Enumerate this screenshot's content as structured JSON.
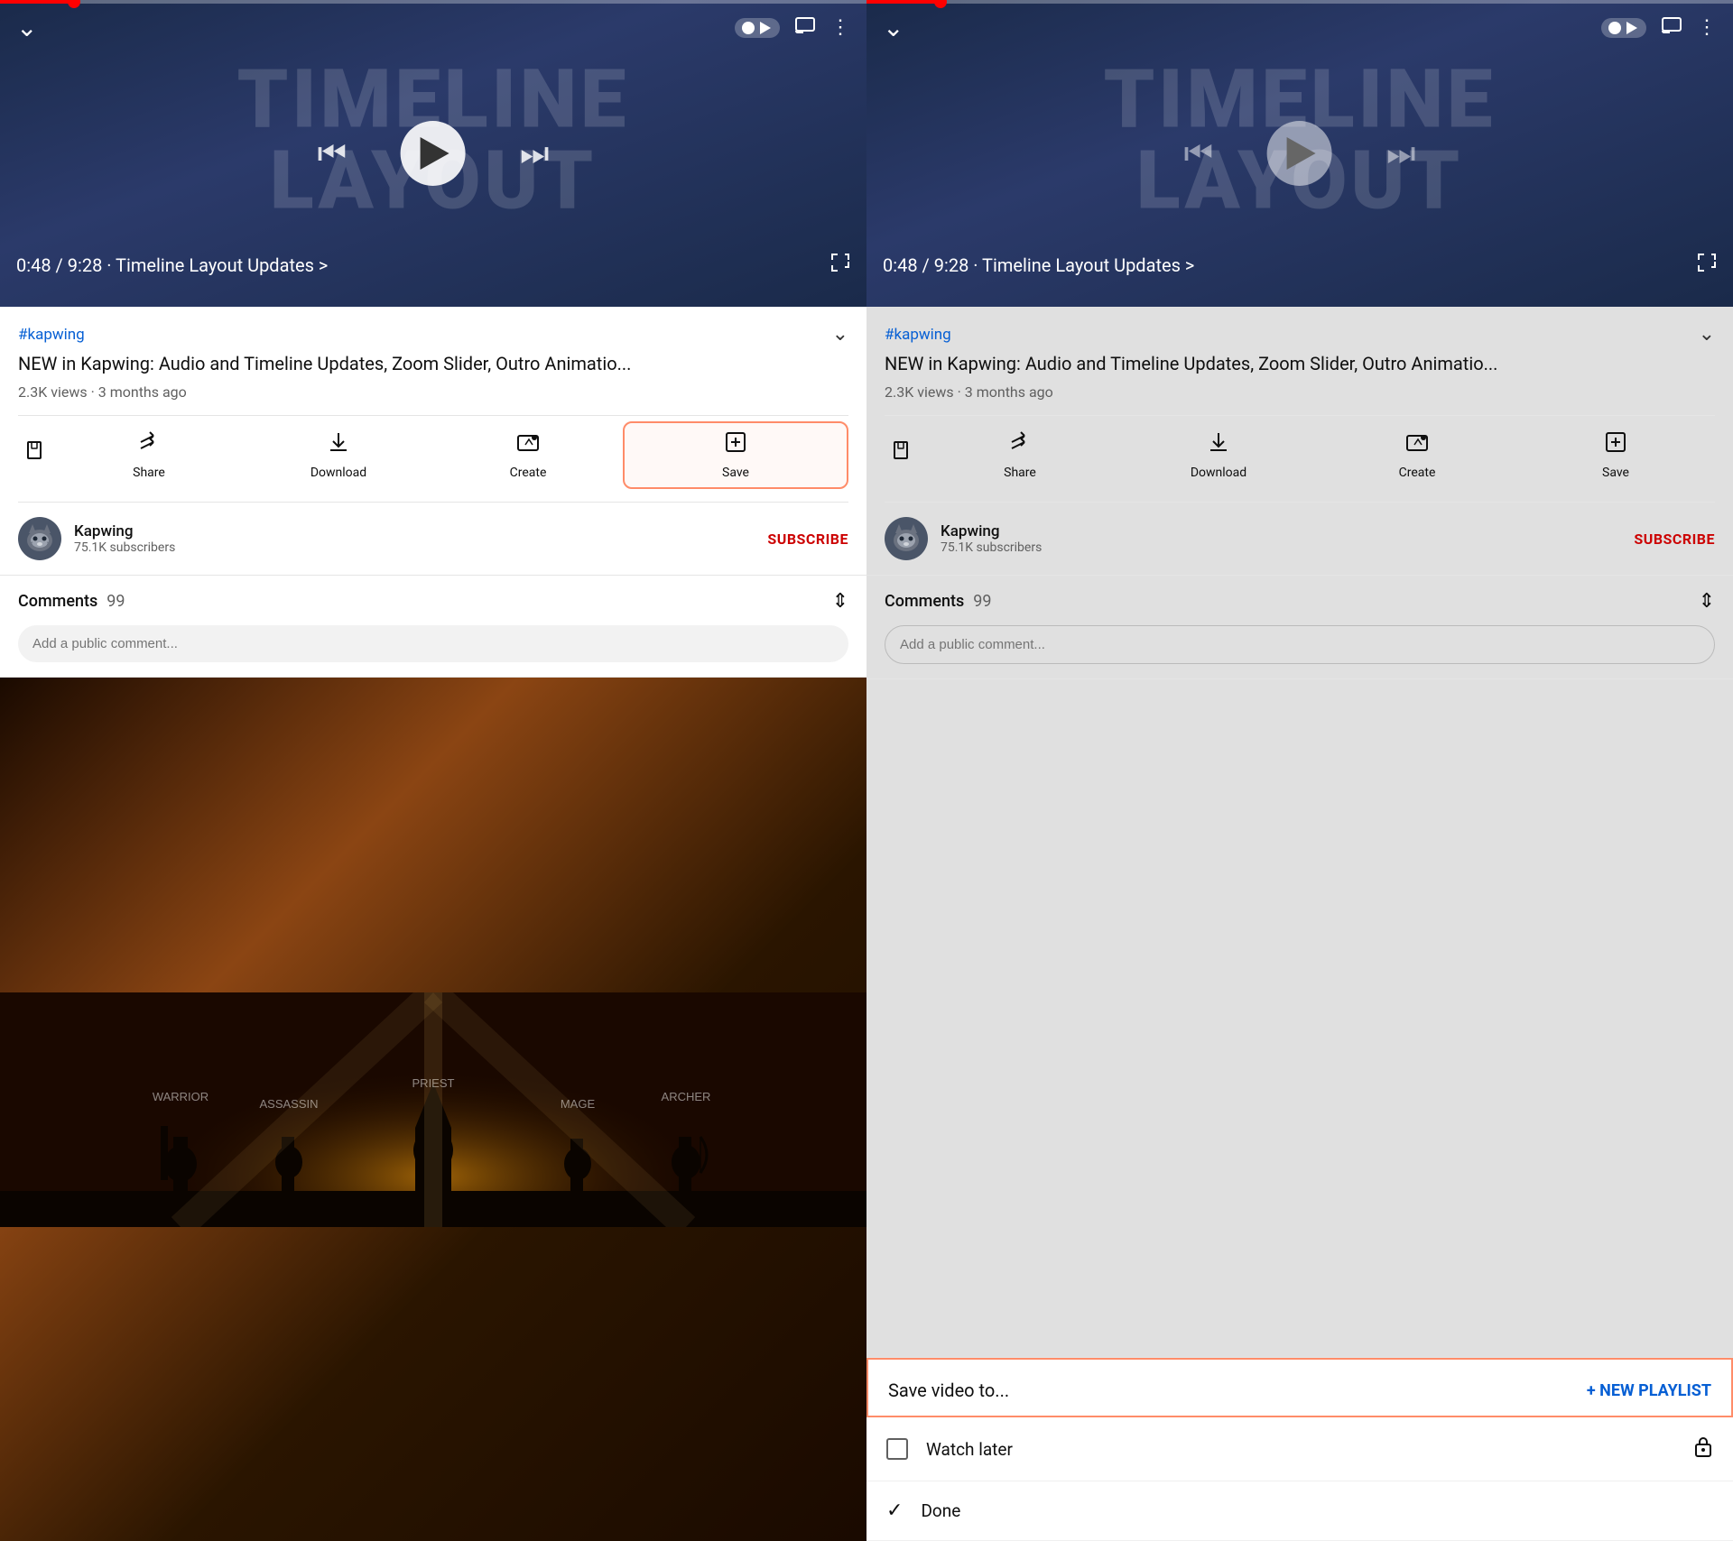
{
  "panels": [
    {
      "id": "left",
      "video": {
        "title_bg": "TIMELINE\nLAYOUT",
        "time": "0:48 / 9:28 · Timeline Layout Updates >",
        "progress_percent": 8.5
      },
      "hashtag": "#kapwing",
      "video_title": "NEW in Kapwing: Audio and Timeline Updates, Zoom Slider, Outro Animatio...",
      "meta": "2.3K views · 3 months ago",
      "actions": [
        {
          "id": "save-left",
          "icon": "↓",
          "label": "Save"
        },
        {
          "id": "share",
          "icon": "↗",
          "label": "Share"
        },
        {
          "id": "download",
          "icon": "↓",
          "label": "Download"
        },
        {
          "id": "create",
          "icon": "📷",
          "label": "Create"
        },
        {
          "id": "save",
          "icon": "＋",
          "label": "Save",
          "highlighted": true
        }
      ],
      "channel_name": "Kapwing",
      "channel_subs": "75.1K subscribers",
      "subscribe": "SUBSCRIBE",
      "comments_label": "Comments",
      "comments_count": "99",
      "comment_placeholder": "Add a public comment...",
      "has_thumbnail": true
    },
    {
      "id": "right",
      "video": {
        "title_bg": "TIMELINE\nLAYOUT",
        "time": "0:48 / 9:28 · Timeline Layout Updates >",
        "progress_percent": 8.5
      },
      "hashtag": "#kapwing",
      "video_title": "NEW in Kapwing: Audio and Timeline Updates, Zoom Slider, Outro Animatio...",
      "meta": "2.3K views · 3 months ago",
      "actions": [
        {
          "id": "save-right",
          "icon": "↓",
          "label": "Save"
        },
        {
          "id": "share-r",
          "icon": "↗",
          "label": "Share"
        },
        {
          "id": "download-r",
          "icon": "↓",
          "label": "Download"
        },
        {
          "id": "create-r",
          "icon": "📷",
          "label": "Create"
        },
        {
          "id": "save-r",
          "icon": "＋",
          "label": "Save"
        }
      ],
      "channel_name": "Kapwing",
      "channel_subs": "75.1K subscribers",
      "subscribe": "SUBSCRIBE",
      "comments_label": "Comments",
      "comments_count": "99",
      "comment_placeholder": "Add a public comment...",
      "save_panel": {
        "label": "Save video to...",
        "new_playlist_label": "+ NEW PLAYLIST",
        "items": [
          {
            "type": "checkbox",
            "name": "Watch later",
            "locked": true
          },
          {
            "type": "check",
            "name": "Done",
            "locked": false
          }
        ]
      }
    }
  ],
  "ui": {
    "subscribe_color": "#cc0000",
    "highlight_color": "#ff8c69",
    "accent_color": "#065fd4"
  }
}
